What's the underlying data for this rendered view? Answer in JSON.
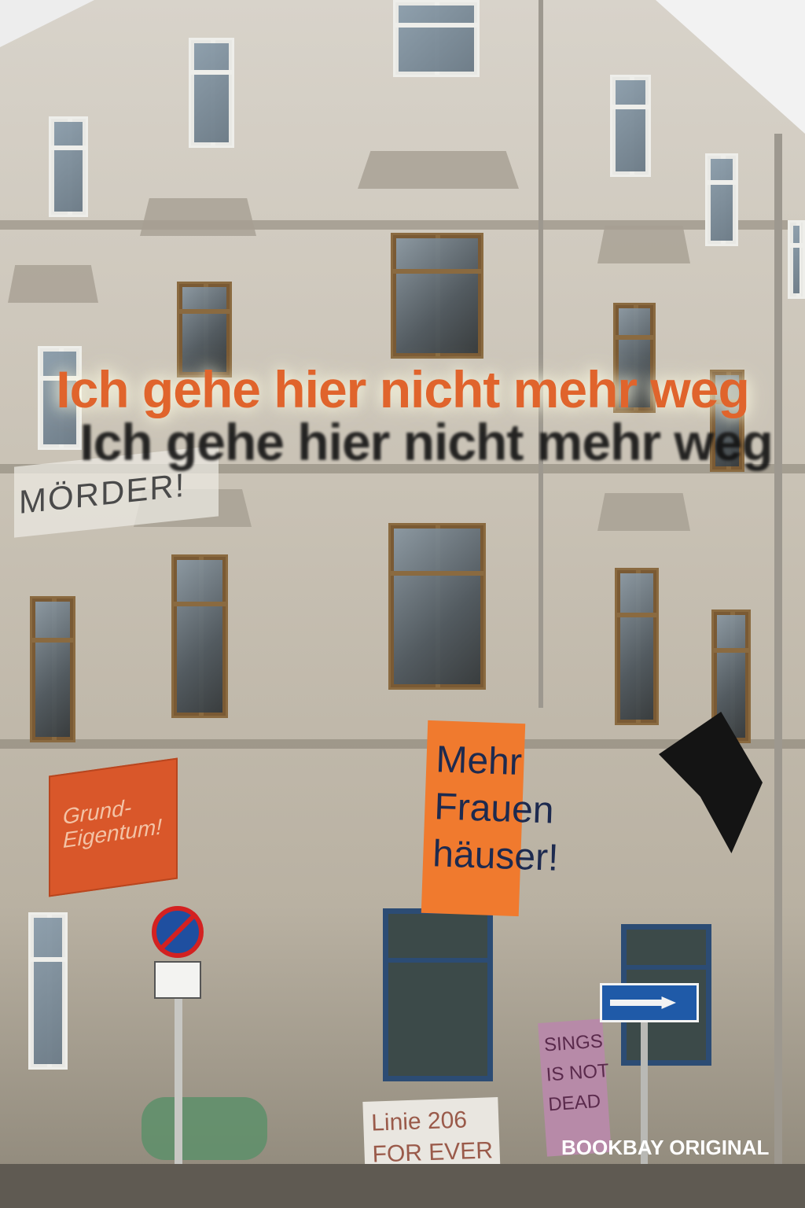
{
  "cover": {
    "title": "Ich gehe hier nicht mehr weg",
    "title_shadow": "Ich gehe hier nicht mehr weg",
    "publisher": "BOOKBAY ORIGINAL"
  },
  "colors": {
    "title": "#e0642c",
    "shadow": "#121212",
    "publisher": "#ffffff"
  },
  "scene": {
    "banner_red": "Grund-\nEigentum!",
    "banner_orange": "Mehr\nFrauen\nhäuser!",
    "wall_graffiti": "MÖRDER!",
    "slogan_box": "Linie 206\nFOR EVER",
    "sticker": "SINGS\nIS NOT\nDEAD"
  }
}
